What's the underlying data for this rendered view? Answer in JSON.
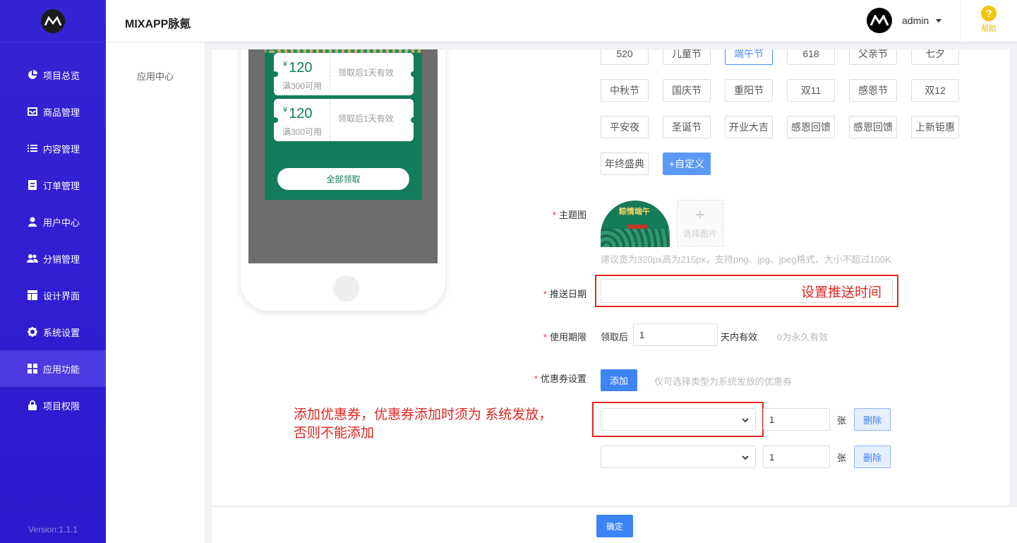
{
  "sidebar": {
    "items": [
      {
        "label": "项目总览",
        "icon": "pie-chart-icon"
      },
      {
        "label": "商品管理",
        "icon": "inbox-icon"
      },
      {
        "label": "内容管理",
        "icon": "list-icon"
      },
      {
        "label": "订单管理",
        "icon": "order-icon"
      },
      {
        "label": "用户中心",
        "icon": "user-icon"
      },
      {
        "label": "分销管理",
        "icon": "users-icon"
      },
      {
        "label": "设计界面",
        "icon": "layout-icon"
      },
      {
        "label": "系统设置",
        "icon": "gear-icon"
      },
      {
        "label": "应用功能",
        "icon": "grid-icon",
        "active": true
      },
      {
        "label": "项目权限",
        "icon": "lock-icon"
      }
    ],
    "version": "Version:1.1.1"
  },
  "header": {
    "title": "MIXAPP脉氪",
    "user": "admin",
    "help": "帮助"
  },
  "subnav": {
    "item": "应用中心"
  },
  "preview": {
    "coupons": [
      {
        "yen": "¥",
        "amount": "120",
        "condition": "满300可用",
        "validity": "领取后1天有效"
      },
      {
        "yen": "¥",
        "amount": "120",
        "condition": "满300可用",
        "validity": "领取后1天有效"
      }
    ],
    "claim_all": "全部领取"
  },
  "festival_tags": [
    "520",
    "儿童节",
    "端午节",
    "618",
    "父亲节",
    "七夕",
    "中秋节",
    "国庆节",
    "重阳节",
    "双11",
    "感恩节",
    "双12",
    "平安夜",
    "圣诞节",
    "开业大吉",
    "感恩回馈",
    "感恩回馈",
    "上新钜惠",
    "年终盛典"
  ],
  "selected_tag": "端午节",
  "custom_tag": "+自定义",
  "form": {
    "theme_label": "主题图",
    "theme_image_text": "粽情端午",
    "upload_text": "选择图片",
    "upload_plus": "+",
    "theme_hint": "建议宽为320px高为215px，支持png、jpg、jpeg格式，大小不超过100K",
    "push_date_label": "推送日期",
    "validity_label": "使用期限",
    "validity_prefix": "领取后",
    "validity_value": "1",
    "validity_suffix": "天内有效",
    "validity_hint": "0为永久有效",
    "coupon_label": "优惠券设置",
    "add_button": "添加",
    "coupon_hint": "仅可选择类型为系统发放的优惠券",
    "coupon_rows": [
      {
        "qty": "1",
        "unit": "张",
        "delete": "删除"
      },
      {
        "qty": "1",
        "unit": "张",
        "delete": "删除"
      }
    ]
  },
  "annotations": {
    "push_time": "设置推送时间",
    "coupon_line1": "添加优惠券，优惠券添加时须为  系统发放，",
    "coupon_line2": "否则不能添加"
  },
  "footer": {
    "confirm": "确定"
  },
  "colors": {
    "sidebar": "#2b1bce",
    "primary": "#3d84f7",
    "annotation": "#e0261f",
    "promo_green": "#127c5d"
  }
}
